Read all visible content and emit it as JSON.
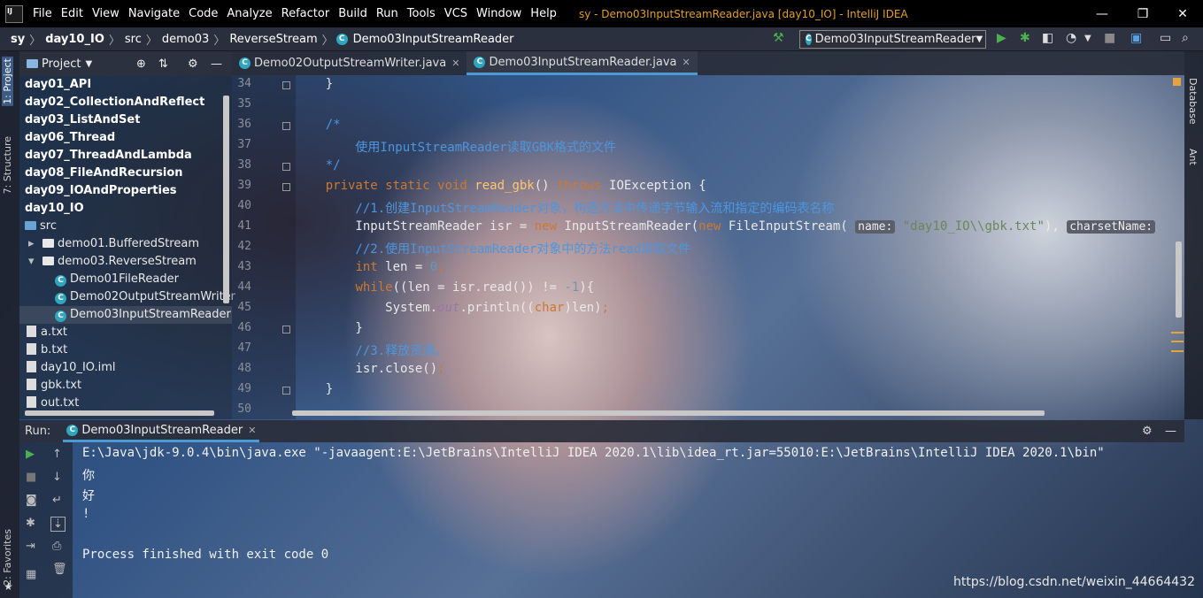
{
  "menu": {
    "items": [
      "File",
      "Edit",
      "View",
      "Navigate",
      "Code",
      "Analyze",
      "Refactor",
      "Build",
      "Run",
      "Tools",
      "VCS",
      "Window",
      "Help"
    ],
    "window_title": "sy - Demo03InputStreamReader.java [day10_IO] - IntelliJ IDEA"
  },
  "nav": {
    "breadcrumbs": [
      "sy",
      "day10_IO",
      "src",
      "demo03",
      "ReverseStream",
      "Demo03InputStreamReader"
    ],
    "run_config": "Demo03InputStreamReader"
  },
  "sidebar": {
    "tabs": [
      "1: Project",
      "7: Structure",
      "2: Favorites"
    ],
    "project_label": "Project"
  },
  "tree": [
    {
      "label": "day01_API",
      "kind": "module"
    },
    {
      "label": "day02_CollectionAndReflect",
      "kind": "module"
    },
    {
      "label": "day03_ListAndSet",
      "kind": "module"
    },
    {
      "label": "day06_Thread",
      "kind": "module"
    },
    {
      "label": "day07_ThreadAndLambda",
      "kind": "module"
    },
    {
      "label": "day08_FileAndRecursion",
      "kind": "module"
    },
    {
      "label": "day09_IOAndProperties",
      "kind": "module"
    },
    {
      "label": "day10_IO",
      "kind": "module"
    },
    {
      "label": "src",
      "kind": "folder"
    },
    {
      "label": "demo01.BufferedStream",
      "kind": "package",
      "arrow": "▸"
    },
    {
      "label": "demo03.ReverseStream",
      "kind": "package",
      "arrow": "▾"
    },
    {
      "label": "Demo01FileReader",
      "kind": "class"
    },
    {
      "label": "Demo02OutputStreamWriter",
      "kind": "class"
    },
    {
      "label": "Demo03InputStreamReader",
      "kind": "class",
      "selected": true
    },
    {
      "label": "a.txt",
      "kind": "file"
    },
    {
      "label": "b.txt",
      "kind": "file"
    },
    {
      "label": "day10_IO.iml",
      "kind": "file"
    },
    {
      "label": "gbk.txt",
      "kind": "file"
    },
    {
      "label": "out.txt",
      "kind": "file"
    }
  ],
  "editor": {
    "tabs": [
      {
        "label": "Demo02OutputStreamWriter.java",
        "active": false
      },
      {
        "label": "Demo03InputStreamReader.java",
        "active": true
      }
    ],
    "line_numbers": [
      "34",
      "35",
      "36",
      "37",
      "38",
      "39",
      "40",
      "41",
      "42",
      "43",
      "44",
      "45",
      "46",
      "47",
      "48",
      "49",
      "50"
    ],
    "code": [
      [
        {
          "t": "    }"
        }
      ],
      [
        {
          "t": ""
        }
      ],
      [
        {
          "t": "    /*",
          "c": "cm"
        }
      ],
      [
        {
          "t": "        使用InputStreamReader读取GBK格式的文件",
          "c": "cm"
        }
      ],
      [
        {
          "t": "    */",
          "c": "cm"
        }
      ],
      [
        {
          "t": "    private static void ",
          "c": "kw"
        },
        {
          "t": "read_gbk",
          "c": "fn"
        },
        {
          "t": "() "
        },
        {
          "t": "throws ",
          "c": "kw"
        },
        {
          "t": "IOException {"
        }
      ],
      [
        {
          "t": "        //1.创建InputStreamReader对象，构造方法中传递字节输入流和指定的编码表名称",
          "c": "cm"
        }
      ],
      [
        {
          "t": "        InputStreamReader isr = "
        },
        {
          "t": "new ",
          "c": "kw"
        },
        {
          "t": "InputStreamReader("
        },
        {
          "t": "new ",
          "c": "kw"
        },
        {
          "t": "FileInputStream( "
        },
        {
          "t": "name:",
          "c": "hint"
        },
        {
          "t": " "
        },
        {
          "t": "\"day10_IO\\\\gbk.txt\"",
          "c": "str"
        },
        {
          "t": "), "
        },
        {
          "t": "charsetName:",
          "c": "hint"
        }
      ],
      [
        {
          "t": "        //2.使用InputStreamReader对象中的方法read读取文件",
          "c": "cm"
        }
      ],
      [
        {
          "t": "        "
        },
        {
          "t": "int ",
          "c": "kw"
        },
        {
          "t": "len = "
        },
        {
          "t": "0",
          "c": "num"
        },
        {
          "t": ";",
          "c": "kw"
        }
      ],
      [
        {
          "t": "        "
        },
        {
          "t": "while",
          "c": "kw"
        },
        {
          "t": "((len = isr.read()) != "
        },
        {
          "t": "-1",
          "c": "num"
        },
        {
          "t": "){"
        }
      ],
      [
        {
          "t": "            System."
        },
        {
          "t": "out",
          "c": "st"
        },
        {
          "t": ".println(("
        },
        {
          "t": "char",
          "c": "kw"
        },
        {
          "t": ")len)"
        },
        {
          "t": ";",
          "c": "kw"
        }
      ],
      [
        {
          "t": "        }"
        }
      ],
      [
        {
          "t": "        //3.释放资源。",
          "c": "cm"
        }
      ],
      [
        {
          "t": "        isr.close()"
        },
        {
          "t": ";",
          "c": "kw"
        }
      ],
      [
        {
          "t": "    }"
        }
      ],
      [
        {
          "t": ""
        }
      ]
    ]
  },
  "right_panel": {
    "tabs": [
      "Database",
      "Ant"
    ]
  },
  "run": {
    "label": "Run:",
    "tab": "Demo03InputStreamReader",
    "output": [
      "E:\\Java\\jdk-9.0.4\\bin\\java.exe \"-javaagent:E:\\JetBrains\\IntelliJ IDEA 2020.1\\lib\\idea_rt.jar=55010:E:\\JetBrains\\IntelliJ IDEA 2020.1\\bin\"",
      "你",
      "好",
      "!",
      "",
      "Process finished with exit code 0"
    ]
  },
  "watermark": "https://blog.csdn.net/weixin_44664432",
  "colors": {
    "keyword": "#cc7832",
    "comment": "#4c96e0",
    "function": "#ffc66d",
    "number": "#6897bb",
    "string": "#6a8759",
    "static_field": "#9876aa"
  }
}
